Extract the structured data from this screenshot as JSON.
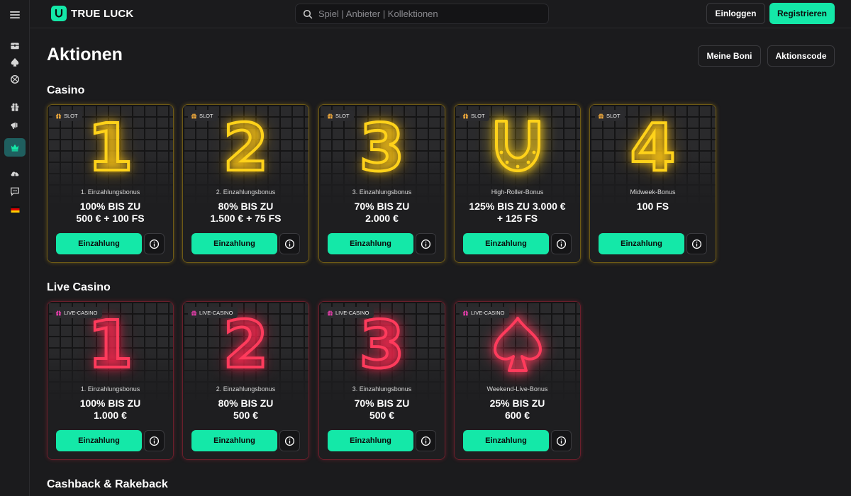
{
  "header": {
    "brand": "TRUE LUCK",
    "search_placeholder": "Spiel | Anbieter | Kollektionen",
    "login_label": "Einloggen",
    "register_label": "Registrieren"
  },
  "sidebar": {
    "items": [
      {
        "icon": "menu-icon"
      },
      {
        "icon": "chest-icon"
      },
      {
        "icon": "spade-icon"
      },
      {
        "icon": "sports-ball-icon"
      },
      {
        "icon": "gift-icon"
      },
      {
        "icon": "megaphone-icon"
      },
      {
        "icon": "crown-icon",
        "active": true
      },
      {
        "icon": "cloud-download-icon"
      },
      {
        "icon": "chat-icon"
      },
      {
        "icon": "german-flag-icon"
      }
    ]
  },
  "page": {
    "title": "Aktionen",
    "my_bonuses_label": "Meine Boni",
    "promo_code_label": "Aktionscode"
  },
  "sections": {
    "casino": {
      "title": "Casino",
      "cards": [
        {
          "tag": "SLOT",
          "glyph": "1",
          "label": "1. Einzahlungsbonus",
          "offer_line1": "100% BIS ZU",
          "offer_line2": "500 € + 100 FS",
          "button": "Einzahlung"
        },
        {
          "tag": "SLOT",
          "glyph": "2",
          "label": "2. Einzahlungsbonus",
          "offer_line1": "80% BIS ZU",
          "offer_line2": "1.500 € + 75 FS",
          "button": "Einzahlung"
        },
        {
          "tag": "SLOT",
          "glyph": "3",
          "label": "3. Einzahlungsbonus",
          "offer_line1": "70% BIS ZU",
          "offer_line2": "2.000 €",
          "button": "Einzahlung"
        },
        {
          "tag": "SLOT",
          "glyph": "horseshoe",
          "label": "High-Roller-Bonus",
          "offer_line1": "125% BIS ZU 3.000 €",
          "offer_line2": "+ 125 FS",
          "button": "Einzahlung"
        },
        {
          "tag": "SLOT",
          "glyph": "4",
          "label": "Midweek-Bonus",
          "offer_line1": "100 FS",
          "offer_line2": "",
          "button": "Einzahlung"
        }
      ]
    },
    "live_casino": {
      "title": "Live Casino",
      "cards": [
        {
          "tag": "LIVE-CASINO",
          "glyph": "1",
          "label": "1. Einzahlungsbonus",
          "offer_line1": "100% BIS ZU",
          "offer_line2": "1.000 €",
          "button": "Einzahlung"
        },
        {
          "tag": "LIVE-CASINO",
          "glyph": "2",
          "label": "2. Einzahlungsbonus",
          "offer_line1": "80% BIS ZU",
          "offer_line2": "500 €",
          "button": "Einzahlung"
        },
        {
          "tag": "LIVE-CASINO",
          "glyph": "3",
          "label": "3. Einzahlungsbonus",
          "offer_line1": "70% BIS ZU",
          "offer_line2": "500 €",
          "button": "Einzahlung"
        },
        {
          "tag": "LIVE-CASINO",
          "glyph": "spade",
          "label": "Weekend-Live-Bonus",
          "offer_line1": "25% BIS ZU",
          "offer_line2": "600 €",
          "button": "Einzahlung"
        }
      ]
    },
    "cashback": {
      "title": "Cashback & Rakeback"
    }
  },
  "colors": {
    "accent": "#14e8a8",
    "background": "#1b1b1d",
    "slot_neon": "#ffd21a",
    "live_neon": "#ff3b5c"
  }
}
